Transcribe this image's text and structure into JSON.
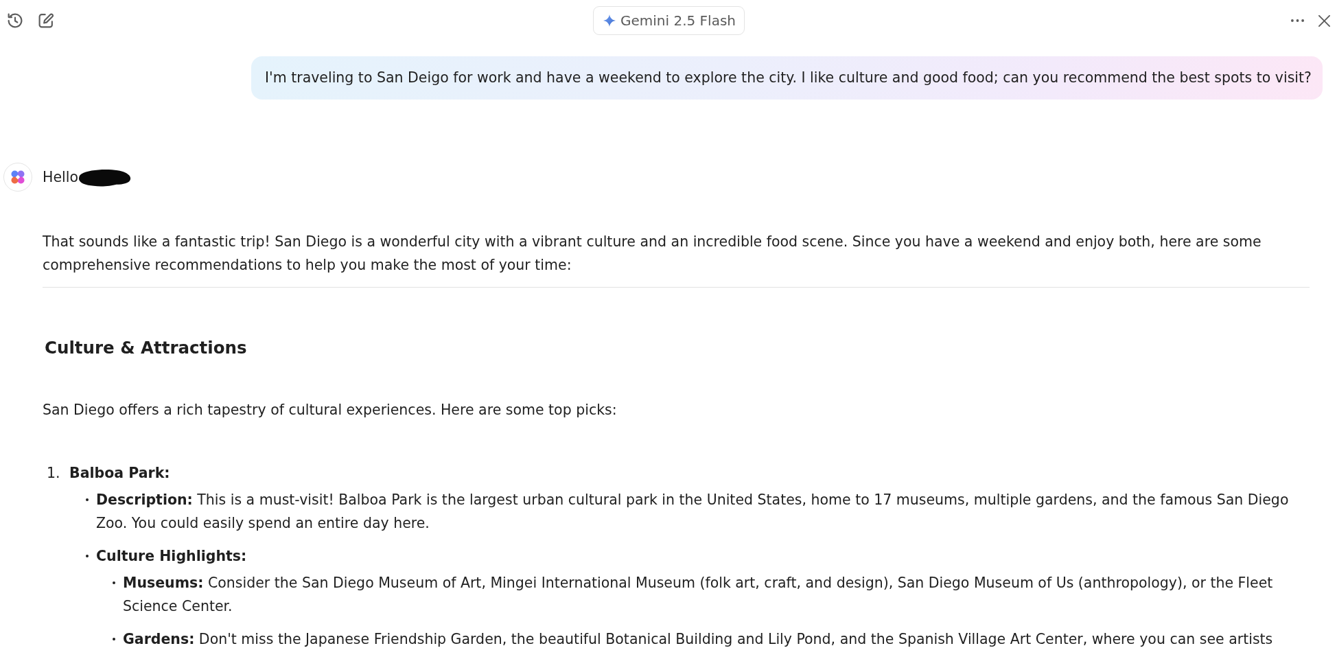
{
  "toolbar": {
    "model_label": "Gemini 2.5 Flash"
  },
  "user_message": {
    "text": "I'm traveling to San Deigo for work and have a weekend to explore the city. I like culture and good food; can you recommend the best spots to visit?"
  },
  "response": {
    "greeting": "Hello",
    "name_redacted": true,
    "blocks": [
      {
        "kind": "paragraph",
        "text": "That sounds like a fantastic trip! San Diego is a wonderful city with a vibrant culture and an incredible food scene. Since you have a weekend and enjoy both, here are some comprehensive recommendations to help you make the most of your time:"
      },
      {
        "kind": "divider"
      },
      {
        "kind": "heading",
        "text": "Culture & Attractions"
      },
      {
        "kind": "paragraph",
        "text": "San Diego offers a rich tapestry of cultural experiences. Here are some top picks:"
      },
      {
        "kind": "ordered_list",
        "items": [
          {
            "number": "1.",
            "label": "Balboa Park:",
            "children": [
              {
                "label": "Description:",
                "text": "This is a must-visit! Balboa Park is the largest urban cultural park in the United States, home to 17 museums, multiple gardens, and the famous San Diego Zoo. You could easily spend an entire day here."
              },
              {
                "label": "Culture Highlights:",
                "children": [
                  {
                    "label": "Museums:",
                    "text": "Consider the San Diego Museum of Art, Mingei International Museum (folk art, craft, and design), San Diego Museum of Us (anthropology), or the Fleet Science Center."
                  },
                  {
                    "label": "Gardens:",
                    "text": "Don't miss the Japanese Friendship Garden, the beautiful Botanical Building and Lily Pond, and the Spanish Village Art Center, where you can see artists"
                  }
                ]
              }
            ]
          }
        ]
      }
    ]
  }
}
